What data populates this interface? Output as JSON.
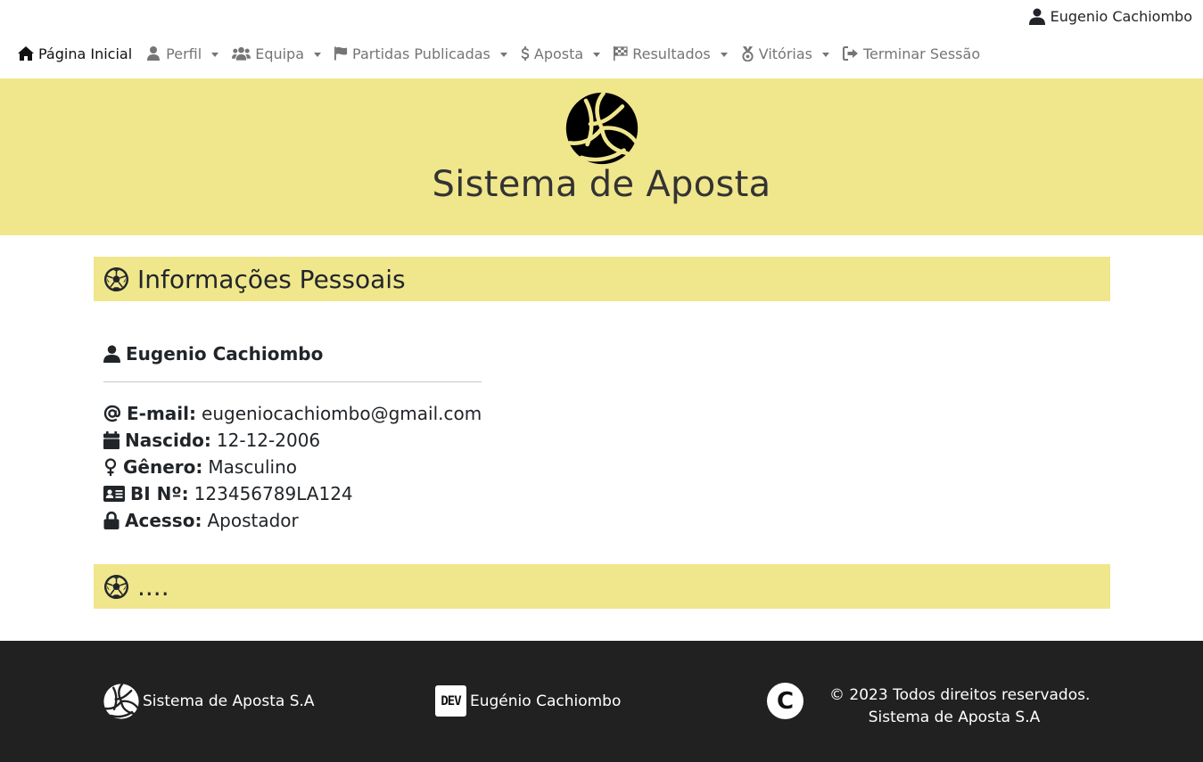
{
  "header": {
    "user_name": "Eugenio Cachiombo"
  },
  "nav": {
    "items": [
      {
        "label": "Página Inicial",
        "icon": "home-icon",
        "active": true,
        "dropdown": false
      },
      {
        "label": "Perfil",
        "icon": "user-icon",
        "active": false,
        "dropdown": true
      },
      {
        "label": "Equipa",
        "icon": "users-icon",
        "active": false,
        "dropdown": true
      },
      {
        "label": "Partidas Publicadas",
        "icon": "flag-icon",
        "active": false,
        "dropdown": true
      },
      {
        "label": "Aposta",
        "icon": "dollar-icon",
        "active": false,
        "dropdown": true
      },
      {
        "label": "Resultados",
        "icon": "checkered-flag-icon",
        "active": false,
        "dropdown": true
      },
      {
        "label": "Vitórias",
        "icon": "medal-icon",
        "active": false,
        "dropdown": true
      },
      {
        "label": "Terminar Sessão",
        "icon": "logout-icon",
        "active": false,
        "dropdown": false
      }
    ]
  },
  "hero": {
    "title": "Sistema de Aposta",
    "logo_icon": "volleyball-icon"
  },
  "section1": {
    "title": "Informações Pessoais",
    "icon": "soccer-ball-icon"
  },
  "profile": {
    "name": "Eugenio Cachiombo",
    "fields": [
      {
        "icon": "at-icon",
        "label": "E-mail:",
        "value": "eugeniocachiombo@gmail.com"
      },
      {
        "icon": "calendar-icon",
        "label": "Nascido:",
        "value": "12-12-2006"
      },
      {
        "icon": "venus-icon",
        "label": "Gênero:",
        "value": "Masculino"
      },
      {
        "icon": "id-card-icon",
        "label": "BI Nº:",
        "value": "123456789LA124"
      },
      {
        "icon": "lock-icon",
        "label": "Acesso:",
        "value": "Apostador"
      }
    ]
  },
  "section2": {
    "title": "....",
    "icon": "soccer-ball-icon"
  },
  "footer": {
    "brand": "Sistema de Aposta S.A",
    "dev_badge": "DEV",
    "dev_name": "Eugénio Cachiombo",
    "copyright_symbol": "C",
    "copyright_line1": "© 2023 Todos direitos reservados.",
    "copyright_line2": "Sistema de Aposta S.A"
  },
  "colors": {
    "accent": "#f0e68c",
    "footer_bg": "#212121",
    "nav_text": "#757575"
  }
}
